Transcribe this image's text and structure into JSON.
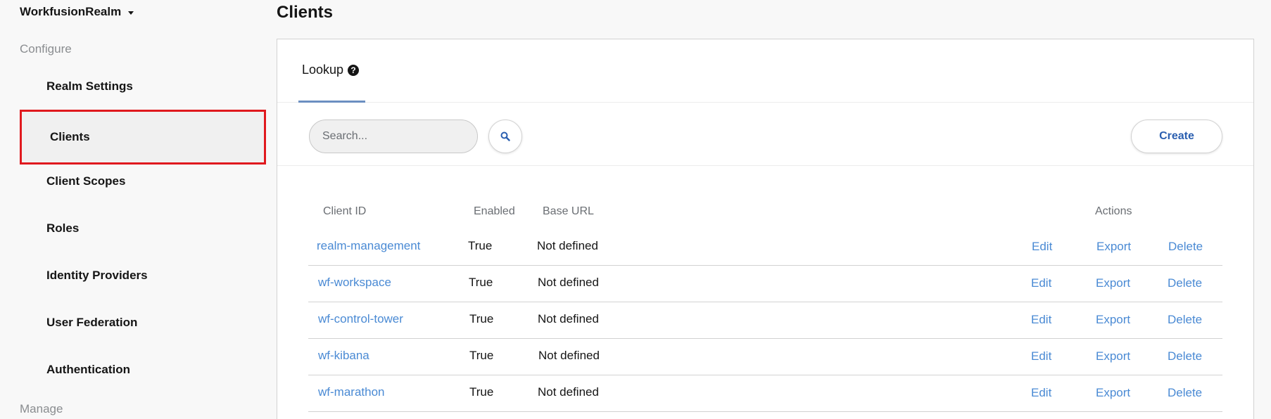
{
  "sidebar": {
    "realm_name": "WorkfusionRealm",
    "configure_label": "Configure",
    "manage_label": "Manage",
    "items": [
      {
        "label": "Realm Settings"
      },
      {
        "label": "Clients"
      },
      {
        "label": "Client Scopes"
      },
      {
        "label": "Roles"
      },
      {
        "label": "Identity Providers"
      },
      {
        "label": "User Federation"
      },
      {
        "label": "Authentication"
      }
    ]
  },
  "page": {
    "title": "Clients",
    "tab_label": "Lookup",
    "search_placeholder": "Search...",
    "create_label": "Create"
  },
  "table": {
    "headers": {
      "client_id": "Client ID",
      "enabled": "Enabled",
      "base_url": "Base URL",
      "actions": "Actions"
    },
    "action_labels": {
      "edit": "Edit",
      "export": "Export",
      "delete": "Delete"
    },
    "rows": [
      {
        "client_id": "realm-management",
        "enabled": "True",
        "base_url": "Not defined"
      },
      {
        "client_id": "wf-workspace",
        "enabled": "True",
        "base_url": "Not defined"
      },
      {
        "client_id": "wf-control-tower",
        "enabled": "True",
        "base_url": "Not defined"
      },
      {
        "client_id": "wf-kibana",
        "enabled": "True",
        "base_url": "Not defined"
      },
      {
        "client_id": "wf-marathon",
        "enabled": "True",
        "base_url": "Not defined"
      }
    ]
  },
  "colors": {
    "accent": "#4a8ad4",
    "primary_button_text": "#2b5fb0",
    "highlight_border": "#e0191e"
  }
}
